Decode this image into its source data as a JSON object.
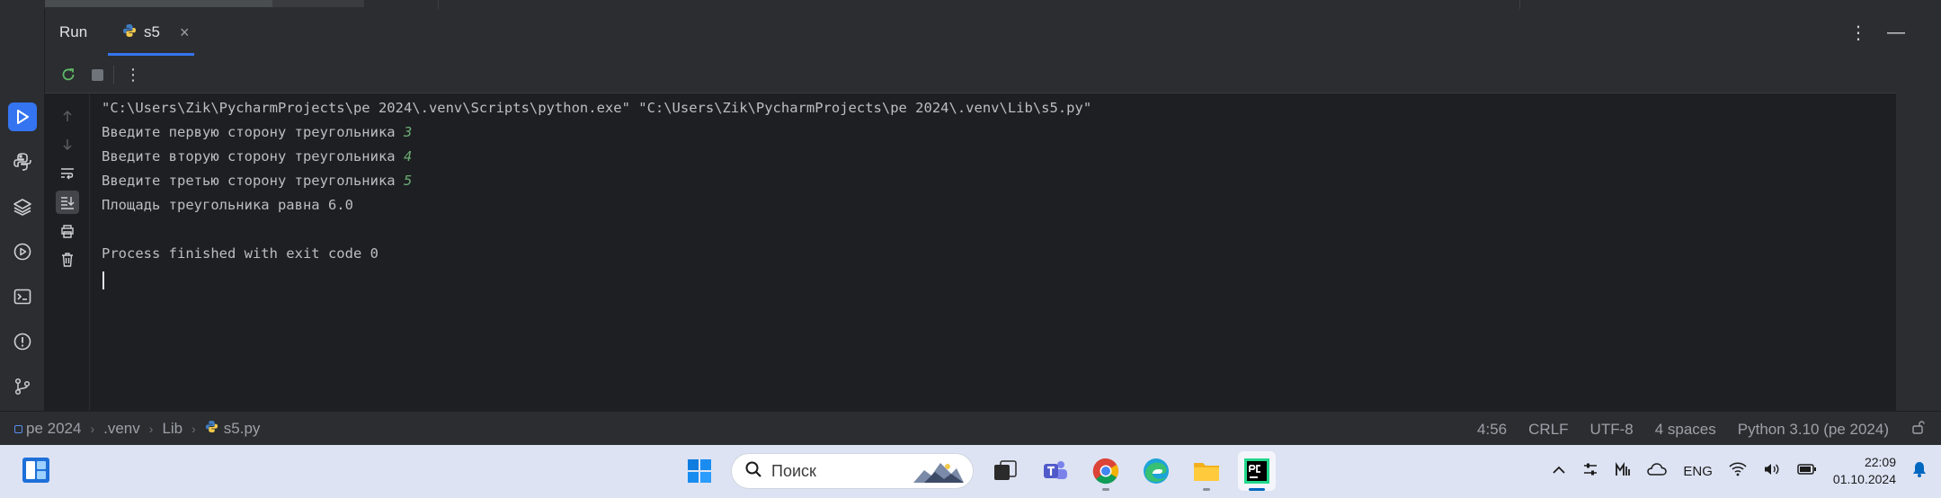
{
  "tool_window": {
    "run_label": "Run",
    "tab_label": "s5",
    "tab_close": "×"
  },
  "console": {
    "lines": [
      "\"C:\\Users\\Zik\\PycharmProjects\\pe 2024\\.venv\\Scripts\\python.exe\" \"C:\\Users\\Zik\\PycharmProjects\\pe 2024\\.venv\\Lib\\s5.py\"",
      "Введите первую сторону треугольника ",
      "Введите вторую сторону треугольника ",
      "Введите третью сторону треугольника ",
      "Площадь треугольника равна 6.0",
      "",
      "Process finished with exit code 0"
    ],
    "inputs": [
      "3",
      "4",
      "5"
    ]
  },
  "breadcrumbs": [
    "pe 2024",
    ".venv",
    "Lib",
    "s5.py"
  ],
  "status": {
    "position": "4:56",
    "line_sep": "CRLF",
    "encoding": "UTF-8",
    "indent": "4 spaces",
    "interpreter": "Python 3.10 (pe 2024)"
  },
  "taskbar": {
    "search_placeholder": "Поиск",
    "lang": "ENG",
    "time": "22:09",
    "date": "01.10.2024"
  },
  "colors": {
    "accent": "#3574f0",
    "input_green": "#6aab73",
    "pycharm_green": "#21d789"
  }
}
